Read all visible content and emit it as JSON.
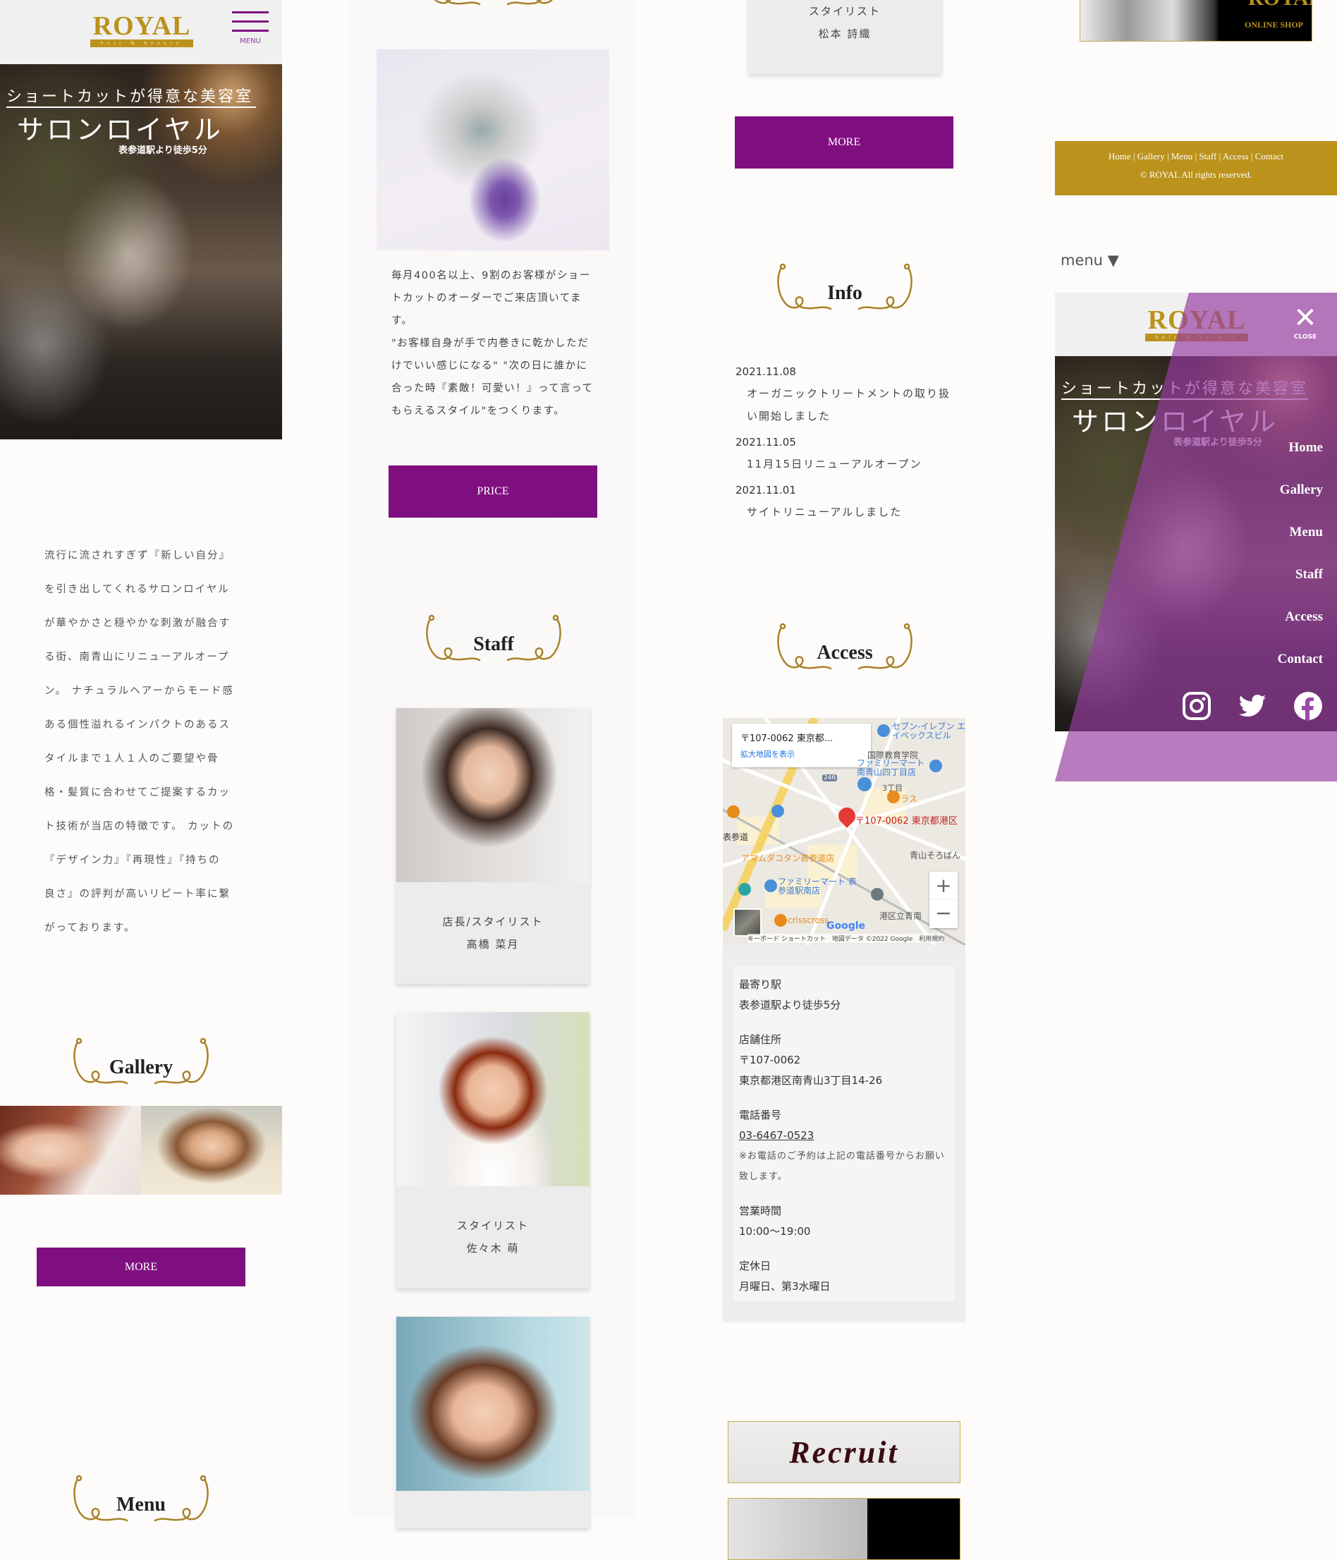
{
  "brand": {
    "logo_word": "ROYAL",
    "logo_sub": "hair & beauty",
    "accent_purple": "#7f0f80",
    "accent_gold": "#bb921b"
  },
  "header": {
    "menu_label": "MENU"
  },
  "hero": {
    "tagline": "ショートカットが得意な美容室",
    "salon_name": "サロンロイヤル",
    "access_note": "表参道駅より徒歩5分"
  },
  "intro": {
    "lines": [
      "流行に流されすぎず『新しい自分』",
      "を引き出してくれるサロンロイヤル",
      "が華やかさと穏やかな刺激が融合す",
      "る街、南青山にリニューアルオープ",
      "ン。 ナチュラルヘアーからモード感",
      "ある個性溢れるインパクトのあるス",
      "タイルまで１人１人のご要望や骨",
      "格・髪質に合わせてご提案するカッ",
      "ト技術が当店の特徴です。 カットの",
      "『デザイン力』『再現性』『持ちの",
      "良さ』の評判が高いリピート率に繋",
      "がっております。"
    ]
  },
  "gallery": {
    "heading": "Gallery",
    "more_label": "MORE"
  },
  "menu_section": {
    "heading": "Menu",
    "description_lines": [
      "毎月400名以上、9割のお客様がショー",
      "トカットのオーダーでご来店頂いてま",
      "す。",
      "\"お客様自身が手で内巻きに乾かしただ",
      "けでいい感じになる\" \"次の日に誰かに",
      "合った時『素敵！可愛い！』って言って",
      "もらえるスタイル\"をつくります。"
    ],
    "price_label": "PRICE"
  },
  "staff": {
    "heading": "Staff",
    "members": [
      {
        "role": "店長/スタイリスト",
        "name": "高橋 菜月"
      },
      {
        "role": "スタイリスト",
        "name": "佐々木 萌"
      },
      {
        "role": "スタイリスト",
        "name": "松本 詩織"
      }
    ],
    "more_label": "MORE"
  },
  "info": {
    "heading": "Info",
    "news": [
      {
        "date": "2021.11.08",
        "text": "オーガニックトリートメントの取り扱い開始しました"
      },
      {
        "date": "2021.11.05",
        "text": "11月15日リニューアルオープン"
      },
      {
        "date": "2021.11.01",
        "text": "サイトリニューアルしました"
      }
    ]
  },
  "access": {
    "heading": "Access",
    "map": {
      "address_card": "〒107-0062 東京都...",
      "view_larger": "拡大地図を表示",
      "pin_label": "〒107-0062 東京都港区",
      "places": [
        "セブン-イレブン エイベックスビル",
        "国際教育学院",
        "ファミリーマート 南青山四丁目店",
        "3丁目",
        "ラス",
        "表参道",
        "アマムダコタン表参道店",
        "青山そろばん",
        "ファミリーマート 表参道駅南店",
        "港区立青南",
        "crisscross",
        "246"
      ],
      "zoom_in": "+",
      "zoom_out": "−",
      "attribution": "キーボード ショートカット　地図データ ©2022 Google　利用規約",
      "google": "Google"
    },
    "details": [
      {
        "label": "最寄り駅",
        "lines": [
          "表参道駅より徒歩5分"
        ]
      },
      {
        "label": "店舗住所",
        "lines": [
          "〒107-0062",
          "東京都港区南青山3丁目14-26"
        ]
      },
      {
        "label": "電話番号",
        "phone": "03-6467-0523",
        "note": "※お電話のご予約は上記の電話番号からお願い致します。"
      },
      {
        "label": "営業時間",
        "lines": [
          "10:00〜19:00"
        ]
      },
      {
        "label": "定休日",
        "lines": [
          "月曜日、第3水曜日"
        ]
      }
    ]
  },
  "banners": {
    "recruit": "Recruit",
    "online_shop": "ONLINE SHOP"
  },
  "footer": {
    "links": [
      "Home",
      "Gallery",
      "Menu",
      "Staff",
      "Access",
      "Contact"
    ],
    "copyright": "© ROYAL All rights reserved."
  },
  "menu_dropdown": {
    "label": "menu ▼"
  },
  "overlay": {
    "close_label": "CLOSE",
    "nav": [
      "Home",
      "Gallery",
      "Menu",
      "Staff",
      "Access",
      "Contact"
    ],
    "social": [
      "instagram-icon",
      "twitter-icon",
      "facebook-icon"
    ],
    "overlay_color": "#b57fc0"
  }
}
